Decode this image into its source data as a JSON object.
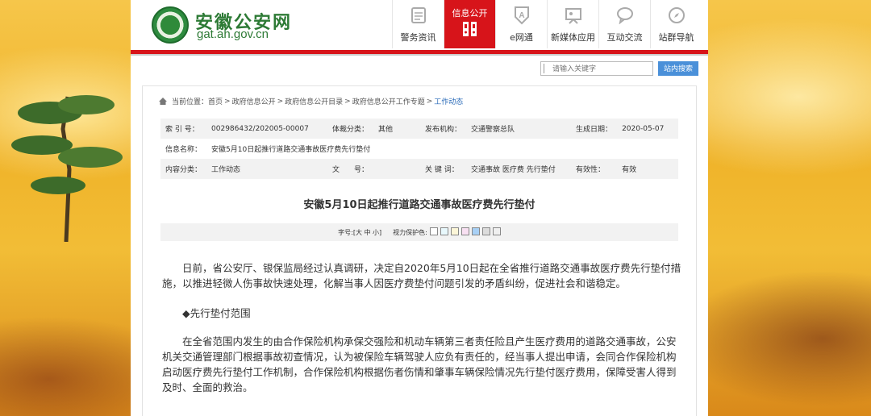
{
  "site": {
    "title": "安徽公安网",
    "url": "gat.ah.gov.cn"
  },
  "nav": [
    {
      "label": "警务资讯",
      "icon": "document-icon",
      "active": false
    },
    {
      "label": "信息公开",
      "icon": "folders-icon",
      "active": true
    },
    {
      "label": "e网通",
      "icon": "e-badge-icon",
      "active": false
    },
    {
      "label": "新媒体应用",
      "icon": "presentation-icon",
      "active": false
    },
    {
      "label": "互动交流",
      "icon": "chat-bubble-icon",
      "active": false
    },
    {
      "label": "站群导航",
      "icon": "compass-icon",
      "active": false
    }
  ],
  "search": {
    "placeholder": "请输入关键字",
    "button": "站内搜索"
  },
  "breadcrumb": {
    "prefix": "当前位置：",
    "items": [
      "首页",
      "政府信息公开",
      "政府信息公开目录",
      "政府信息公开工作专题",
      "工作动态"
    ]
  },
  "meta": {
    "row1": {
      "index_label": "索 引 号：",
      "index_value": "002986432/202005-00007",
      "type_label": "体裁分类：",
      "type_value": "其他",
      "org_label": "发布机构：",
      "org_value": "交通警察总队",
      "date_label": "生成日期：",
      "date_value": "2020-05-07"
    },
    "row2": {
      "name_label": "信息名称：",
      "name_value": "安徽5月10日起推行道路交通事故医疗费先行垫付"
    },
    "row3": {
      "cat_label": "内容分类：",
      "cat_value": "工作动态",
      "num_label": "文　　号：",
      "num_value": "",
      "kw_label": "关 键 词：",
      "kw_value": "交通事故 医疗费 先行垫付",
      "valid_label": "有效性：",
      "valid_value": "有效"
    }
  },
  "article": {
    "title": "安徽5月10日起推行道路交通事故医疗费先行垫付",
    "font_size_label": "字号:[大 中 小]",
    "eye_protect_label": "视力保护色:",
    "swatch_colors": [
      "#ffffff",
      "#e8f8fc",
      "#fcf6d8",
      "#f8e0f2",
      "#a8d0f5",
      "#dcdcdc",
      "#f0f0f0"
    ],
    "para1": "日前，省公安厅、银保监局经过认真调研，决定自2020年5月10日起在全省推行道路交通事故医疗费先行垫付措施，以推进轻微人伤事故快速处理，化解当事人因医疗费垫付问题引发的矛盾纠纷，促进社会和谐稳定。",
    "section1": "◆先行垫付范围",
    "para2": "在全省范围内发生的由合作保险机构承保交强险和机动车辆第三者责任险且产生医疗费用的道路交通事故，公安机关交通管理部门根据事故初查情况，认为被保险车辆驾驶人应负有责任的，经当事人提出申请，会同合作保险机构启动医疗费先行垫付工作机制，合作保险机构根据伤者伤情和肇事车辆保险情况先行垫付医疗费用，保障受害人得到及时、全面的救治。"
  }
}
